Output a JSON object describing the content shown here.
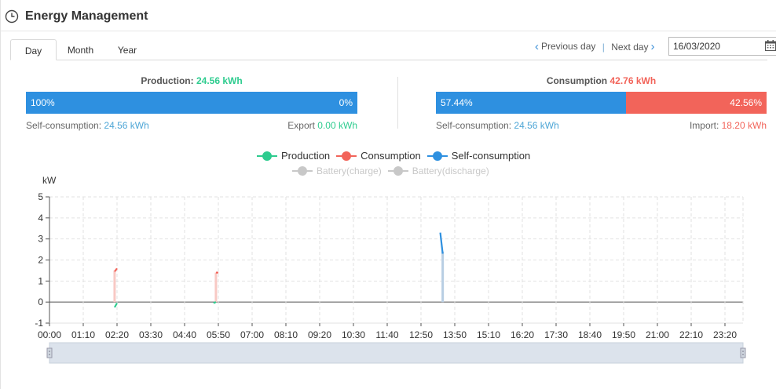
{
  "header": {
    "title": "Energy Management",
    "icon": "clock-icon"
  },
  "tabs": [
    {
      "label": "Day",
      "active": true
    },
    {
      "label": "Month",
      "active": false
    },
    {
      "label": "Year",
      "active": false
    }
  ],
  "nav": {
    "prev_label": "Previous day",
    "next_label": "Next day",
    "date_value": "16/03/2020"
  },
  "production": {
    "title": "Production:",
    "value": "24.56 kWh",
    "bar_left_label": "100%",
    "bar_right_label": "0%",
    "self_consumption_label": "Self-consumption:",
    "self_consumption_value": "24.56 kWh",
    "export_label": "Export",
    "export_value": "0.00 kWh"
  },
  "consumption": {
    "title": "Consumption",
    "value": "42.76 kWh",
    "bar_left_label": "57.44%",
    "bar_right_label": "42.56%",
    "bar_left_percent": 57.44,
    "self_consumption_label": "Self-consumption:",
    "self_consumption_value": "24.56 kWh",
    "import_label": "Import:",
    "import_value": "18.20 kWh"
  },
  "colors": {
    "production": "#2ecc8f",
    "consumption": "#f2645a",
    "self_consumption": "#2e90e0",
    "disabled": "#c8c8c8"
  },
  "chart_data": {
    "type": "line",
    "ylabel": "kW",
    "ylim": [
      -1,
      5
    ],
    "yticks": [
      -1,
      0,
      1,
      2,
      3,
      4,
      5
    ],
    "grid": true,
    "legend_position": "top-center",
    "x_tick_labels": [
      "00:00",
      "01:10",
      "02:20",
      "03:30",
      "04:40",
      "05:50",
      "07:00",
      "08:10",
      "09:20",
      "10:30",
      "11:40",
      "12:50",
      "13:50",
      "15:10",
      "16:20",
      "17:30",
      "18:40",
      "19:50",
      "21:00",
      "22:10",
      "23:20"
    ],
    "series": [
      {
        "name": "Production",
        "enabled": true,
        "segments": [
          [
            [
              "02:15",
              -0.25
            ],
            [
              "02:20",
              -0.05
            ]
          ],
          [
            [
              "05:40",
              -0.05
            ],
            [
              "05:45",
              0.0
            ]
          ]
        ]
      },
      {
        "name": "Consumption",
        "enabled": true,
        "segments": [
          [
            [
              "02:15",
              1.45
            ],
            [
              "02:20",
              1.6
            ]
          ],
          [
            [
              "05:45",
              1.4
            ],
            [
              "05:50",
              1.4
            ]
          ]
        ]
      },
      {
        "name": "Self-consumption",
        "enabled": true,
        "segments": [
          [
            [
              "13:30",
              3.3
            ],
            [
              "13:35",
              2.3
            ]
          ]
        ]
      },
      {
        "name": "Battery(charge)",
        "enabled": false,
        "segments": []
      },
      {
        "name": "Battery(discharge)",
        "enabled": false,
        "segments": []
      }
    ],
    "spikes": [
      {
        "x": "02:15",
        "from": 0,
        "to": 1.5,
        "color": "#f8c9c4"
      },
      {
        "x": "05:45",
        "from": 0,
        "to": 1.4,
        "color": "#f8c9c4"
      },
      {
        "x": "13:35",
        "from": 0,
        "to": 2.4,
        "color": "#b8cee3"
      }
    ]
  }
}
